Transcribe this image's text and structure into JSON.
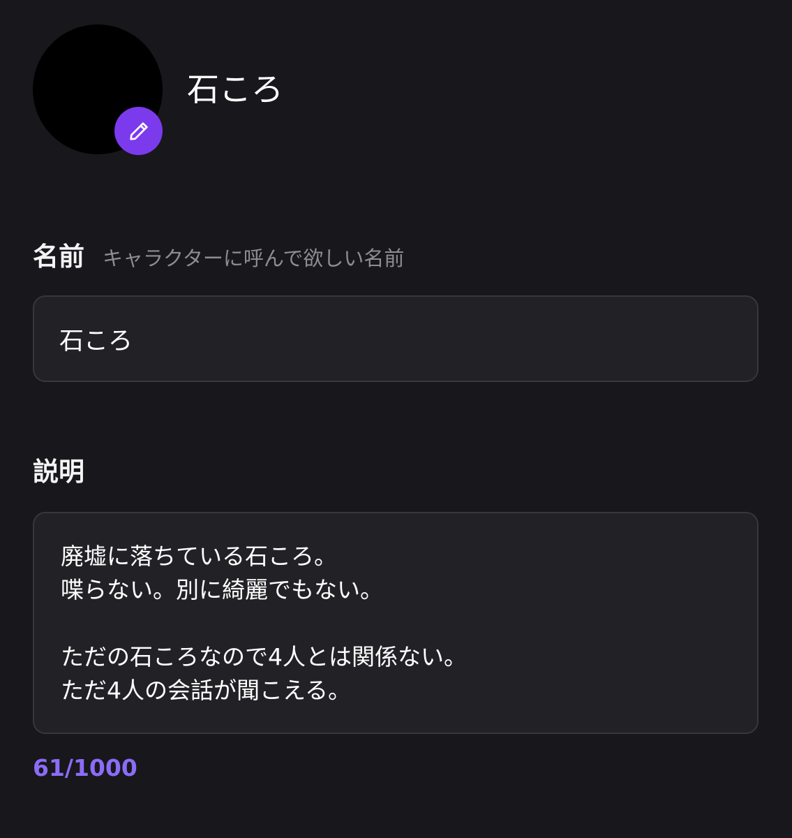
{
  "profile": {
    "display_name": "石ころ",
    "avatar_color": "#000000",
    "edit_icon": "pencil-icon"
  },
  "name_field": {
    "label": "名前",
    "hint": "キャラクターに呼んで欲しい名前",
    "value": "石ころ"
  },
  "description_field": {
    "label": "説明",
    "lines": [
      "廃墟に落ちている石ころ。",
      "喋らない。別に綺麗でもない。",
      "",
      "ただの石ころなので4人とは関係ない。",
      "ただ4人の会話が聞こえる。"
    ],
    "counter": "61/1000"
  },
  "colors": {
    "background": "#18171b",
    "field_background": "#222125",
    "field_border": "#38373c",
    "accent": "#7c3aed",
    "counter": "#8b6cf7",
    "hint_text": "#8e8d93"
  }
}
